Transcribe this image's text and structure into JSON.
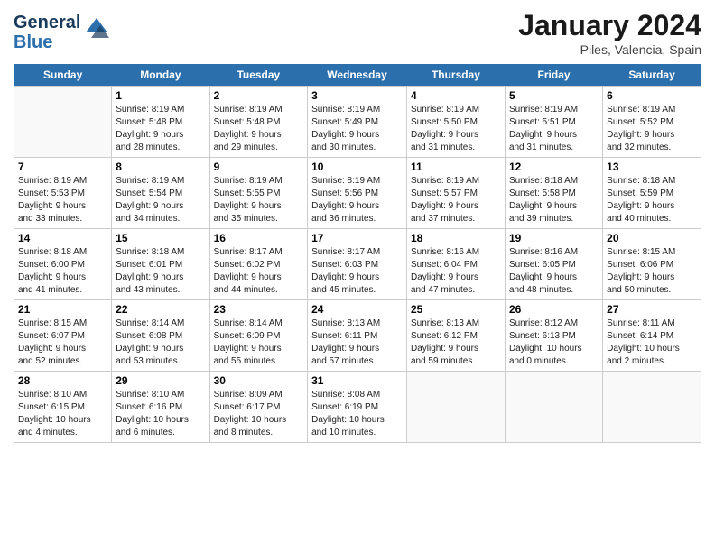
{
  "header": {
    "logo_line1": "General",
    "logo_line2": "Blue",
    "title": "January 2024",
    "subtitle": "Piles, Valencia, Spain"
  },
  "weekdays": [
    "Sunday",
    "Monday",
    "Tuesday",
    "Wednesday",
    "Thursday",
    "Friday",
    "Saturday"
  ],
  "weeks": [
    [
      {
        "day": "",
        "info": ""
      },
      {
        "day": "1",
        "info": "Sunrise: 8:19 AM\nSunset: 5:48 PM\nDaylight: 9 hours\nand 28 minutes."
      },
      {
        "day": "2",
        "info": "Sunrise: 8:19 AM\nSunset: 5:48 PM\nDaylight: 9 hours\nand 29 minutes."
      },
      {
        "day": "3",
        "info": "Sunrise: 8:19 AM\nSunset: 5:49 PM\nDaylight: 9 hours\nand 30 minutes."
      },
      {
        "day": "4",
        "info": "Sunrise: 8:19 AM\nSunset: 5:50 PM\nDaylight: 9 hours\nand 31 minutes."
      },
      {
        "day": "5",
        "info": "Sunrise: 8:19 AM\nSunset: 5:51 PM\nDaylight: 9 hours\nand 31 minutes."
      },
      {
        "day": "6",
        "info": "Sunrise: 8:19 AM\nSunset: 5:52 PM\nDaylight: 9 hours\nand 32 minutes."
      }
    ],
    [
      {
        "day": "7",
        "info": "Sunrise: 8:19 AM\nSunset: 5:53 PM\nDaylight: 9 hours\nand 33 minutes."
      },
      {
        "day": "8",
        "info": "Sunrise: 8:19 AM\nSunset: 5:54 PM\nDaylight: 9 hours\nand 34 minutes."
      },
      {
        "day": "9",
        "info": "Sunrise: 8:19 AM\nSunset: 5:55 PM\nDaylight: 9 hours\nand 35 minutes."
      },
      {
        "day": "10",
        "info": "Sunrise: 8:19 AM\nSunset: 5:56 PM\nDaylight: 9 hours\nand 36 minutes."
      },
      {
        "day": "11",
        "info": "Sunrise: 8:19 AM\nSunset: 5:57 PM\nDaylight: 9 hours\nand 37 minutes."
      },
      {
        "day": "12",
        "info": "Sunrise: 8:18 AM\nSunset: 5:58 PM\nDaylight: 9 hours\nand 39 minutes."
      },
      {
        "day": "13",
        "info": "Sunrise: 8:18 AM\nSunset: 5:59 PM\nDaylight: 9 hours\nand 40 minutes."
      }
    ],
    [
      {
        "day": "14",
        "info": "Sunrise: 8:18 AM\nSunset: 6:00 PM\nDaylight: 9 hours\nand 41 minutes."
      },
      {
        "day": "15",
        "info": "Sunrise: 8:18 AM\nSunset: 6:01 PM\nDaylight: 9 hours\nand 43 minutes."
      },
      {
        "day": "16",
        "info": "Sunrise: 8:17 AM\nSunset: 6:02 PM\nDaylight: 9 hours\nand 44 minutes."
      },
      {
        "day": "17",
        "info": "Sunrise: 8:17 AM\nSunset: 6:03 PM\nDaylight: 9 hours\nand 45 minutes."
      },
      {
        "day": "18",
        "info": "Sunrise: 8:16 AM\nSunset: 6:04 PM\nDaylight: 9 hours\nand 47 minutes."
      },
      {
        "day": "19",
        "info": "Sunrise: 8:16 AM\nSunset: 6:05 PM\nDaylight: 9 hours\nand 48 minutes."
      },
      {
        "day": "20",
        "info": "Sunrise: 8:15 AM\nSunset: 6:06 PM\nDaylight: 9 hours\nand 50 minutes."
      }
    ],
    [
      {
        "day": "21",
        "info": "Sunrise: 8:15 AM\nSunset: 6:07 PM\nDaylight: 9 hours\nand 52 minutes."
      },
      {
        "day": "22",
        "info": "Sunrise: 8:14 AM\nSunset: 6:08 PM\nDaylight: 9 hours\nand 53 minutes."
      },
      {
        "day": "23",
        "info": "Sunrise: 8:14 AM\nSunset: 6:09 PM\nDaylight: 9 hours\nand 55 minutes."
      },
      {
        "day": "24",
        "info": "Sunrise: 8:13 AM\nSunset: 6:11 PM\nDaylight: 9 hours\nand 57 minutes."
      },
      {
        "day": "25",
        "info": "Sunrise: 8:13 AM\nSunset: 6:12 PM\nDaylight: 9 hours\nand 59 minutes."
      },
      {
        "day": "26",
        "info": "Sunrise: 8:12 AM\nSunset: 6:13 PM\nDaylight: 10 hours\nand 0 minutes."
      },
      {
        "day": "27",
        "info": "Sunrise: 8:11 AM\nSunset: 6:14 PM\nDaylight: 10 hours\nand 2 minutes."
      }
    ],
    [
      {
        "day": "28",
        "info": "Sunrise: 8:10 AM\nSunset: 6:15 PM\nDaylight: 10 hours\nand 4 minutes."
      },
      {
        "day": "29",
        "info": "Sunrise: 8:10 AM\nSunset: 6:16 PM\nDaylight: 10 hours\nand 6 minutes."
      },
      {
        "day": "30",
        "info": "Sunrise: 8:09 AM\nSunset: 6:17 PM\nDaylight: 10 hours\nand 8 minutes."
      },
      {
        "day": "31",
        "info": "Sunrise: 8:08 AM\nSunset: 6:19 PM\nDaylight: 10 hours\nand 10 minutes."
      },
      {
        "day": "",
        "info": ""
      },
      {
        "day": "",
        "info": ""
      },
      {
        "day": "",
        "info": ""
      }
    ]
  ]
}
